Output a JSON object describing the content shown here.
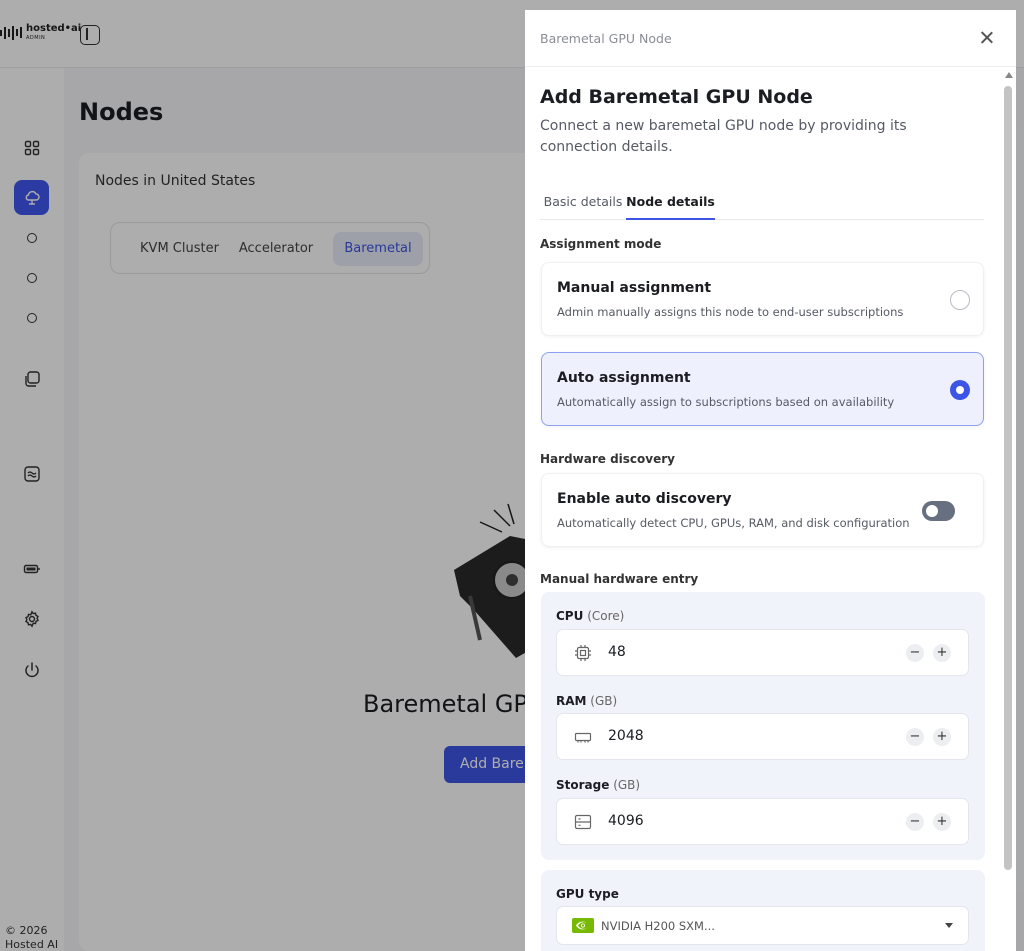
{
  "brand": {
    "name": "hosted•ai",
    "sub": "ADMIN"
  },
  "page": {
    "title": "Nodes",
    "region_label": "Nodes in United States"
  },
  "cluster_tabs": [
    {
      "label": "KVM Cluster",
      "active": false
    },
    {
      "label": "Accelerator",
      "active": false
    },
    {
      "label": "Baremetal",
      "active": true
    }
  ],
  "empty_state": {
    "title": "Baremetal GPU",
    "button": "Add Barem"
  },
  "footer": {
    "line1": "© 2026",
    "line2": "Hosted AI"
  },
  "drawer": {
    "header": "Baremetal GPU Node",
    "title": "Add Baremetal GPU Node",
    "subtitle": "Connect a new baremetal GPU node by providing its connection details.",
    "tabs": [
      {
        "label": "Basic details",
        "active": false
      },
      {
        "label": "Node details",
        "active": true
      }
    ],
    "assignment": {
      "label": "Assignment mode",
      "options": [
        {
          "title": "Manual assignment",
          "desc": "Admin manually assigns this node to end-user subscriptions",
          "selected": false
        },
        {
          "title": "Auto assignment",
          "desc": "Automatically assign to subscriptions based on availability",
          "selected": true
        }
      ]
    },
    "discovery": {
      "label": "Hardware discovery",
      "title": "Enable auto discovery",
      "desc": "Automatically detect CPU, GPUs, RAM, and disk configuration",
      "enabled": false
    },
    "manual_hw": {
      "label": "Manual hardware entry",
      "fields": [
        {
          "name": "CPU",
          "unit": "(Core)",
          "value": "48",
          "icon": "cpu-icon"
        },
        {
          "name": "RAM",
          "unit": "(GB)",
          "value": "2048",
          "icon": "memory-icon"
        },
        {
          "name": "Storage",
          "unit": "(GB)",
          "value": "4096",
          "icon": "storage-icon"
        }
      ],
      "minus": "−",
      "plus": "+"
    },
    "gpu": {
      "label": "GPU type",
      "value": "NVIDIA H200 SXM..."
    }
  },
  "colors": {
    "accent": "#3d55e6",
    "selected_bg": "#eef1fd",
    "toggle_off": "#667081"
  }
}
